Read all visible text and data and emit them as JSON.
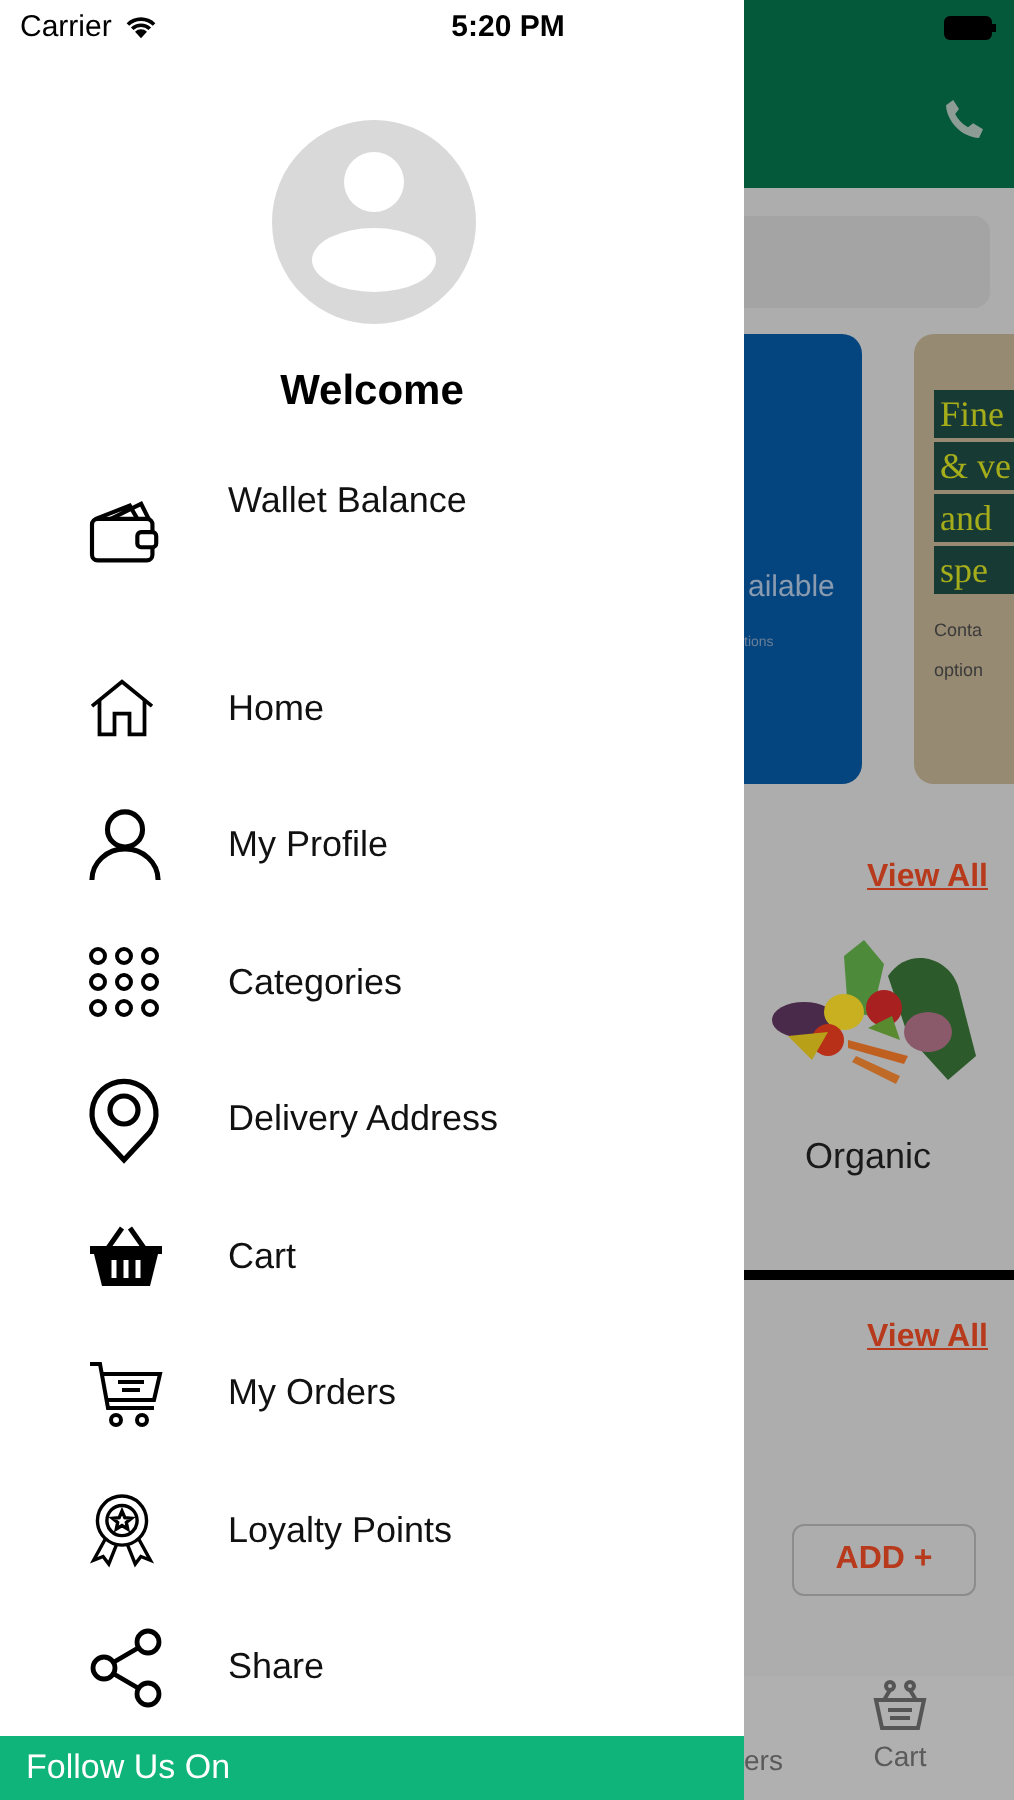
{
  "status_bar": {
    "carrier": "Carrier",
    "time": "5:20 PM"
  },
  "drawer": {
    "welcome": "Welcome",
    "menu": [
      {
        "label": "Wallet Balance"
      },
      {
        "label": "Home"
      },
      {
        "label": "My Profile"
      },
      {
        "label": "Categories"
      },
      {
        "label": "Delivery Address"
      },
      {
        "label": "Cart"
      },
      {
        "label": "My Orders"
      },
      {
        "label": "Loyalty Points"
      },
      {
        "label": "Share"
      }
    ],
    "footer": "Follow Us On"
  },
  "background_page": {
    "banners": [
      {
        "kind": "blue",
        "lines": [
          "ailable"
        ],
        "note": "tions"
      },
      {
        "kind": "beige",
        "lines": [
          "Fine",
          "& ve",
          "and",
          "spe"
        ],
        "note": "Conta option"
      }
    ],
    "sections": [
      {
        "link": "View All",
        "item": "Organic"
      },
      {
        "link": "View All",
        "button": "ADD +"
      }
    ],
    "bottom_nav": [
      "ers",
      "Cart"
    ]
  }
}
